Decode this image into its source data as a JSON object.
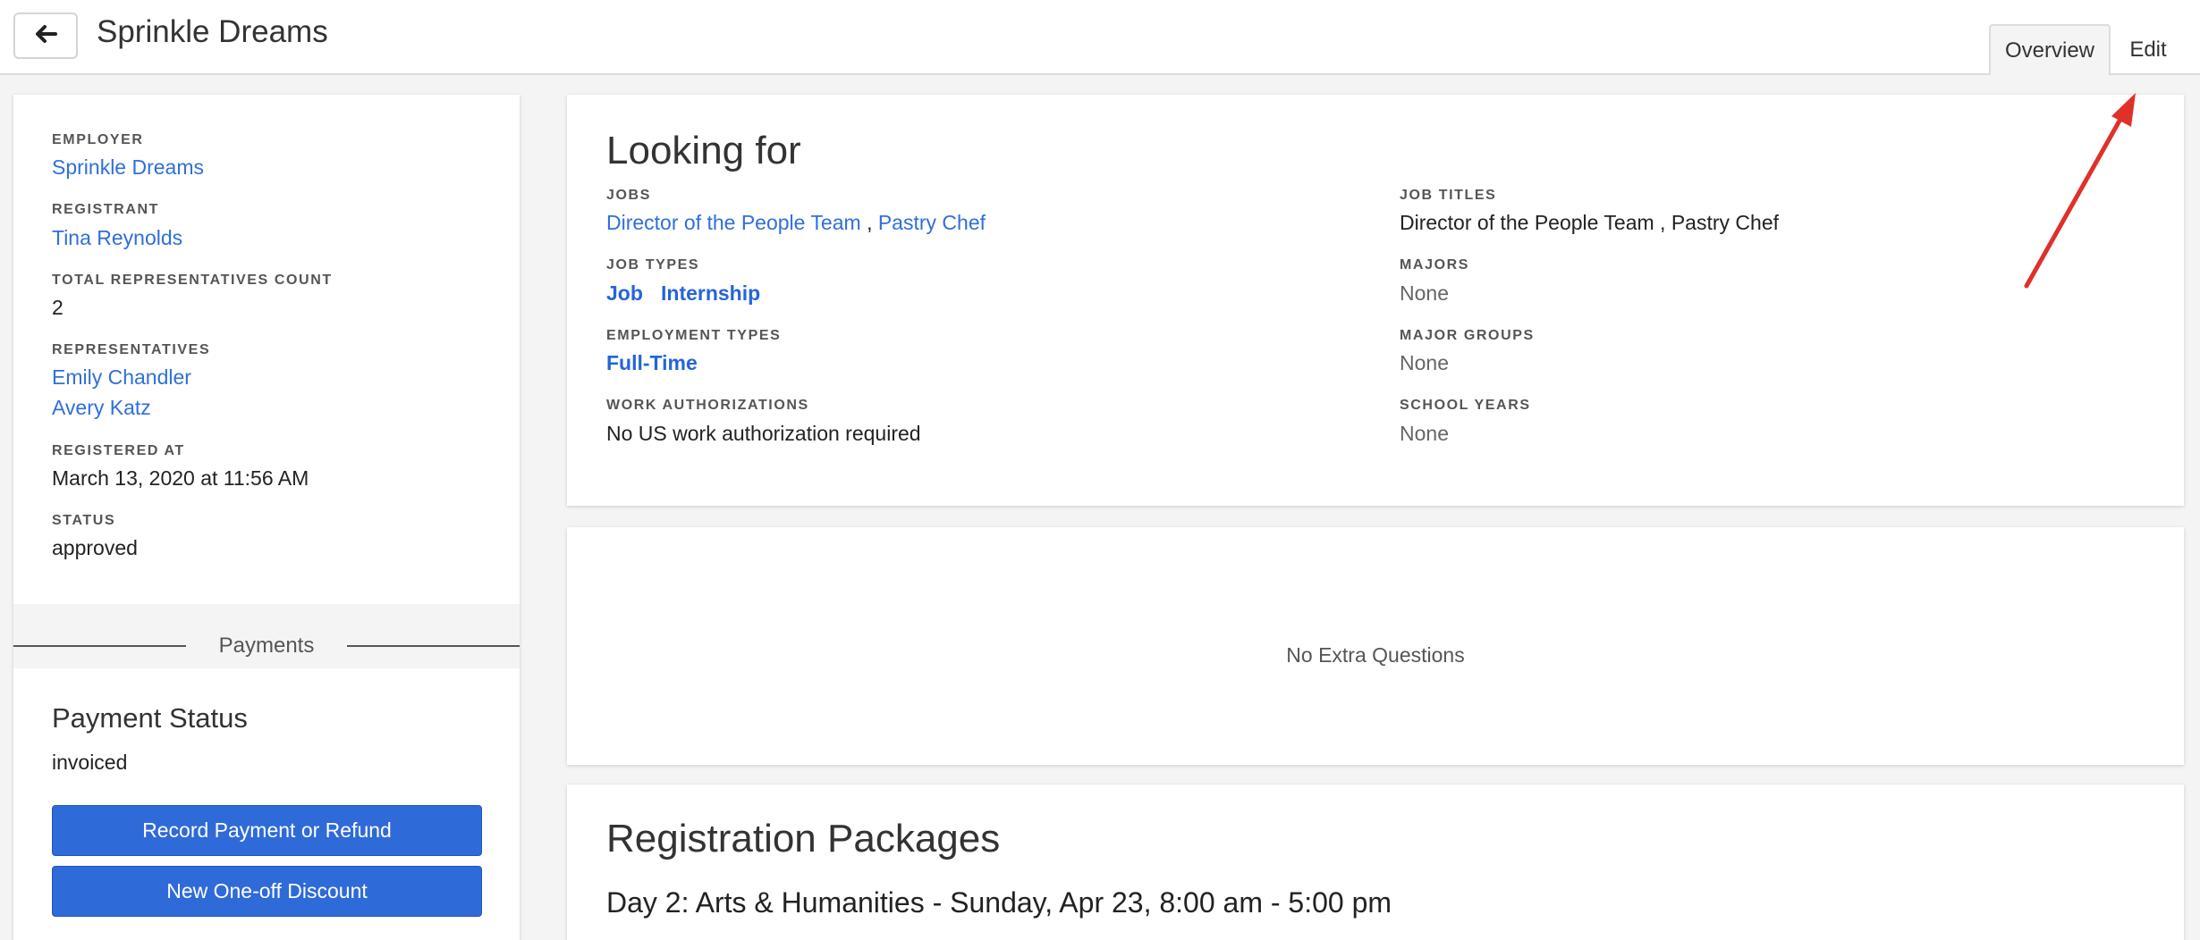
{
  "header": {
    "title": "Sprinkle Dreams",
    "back_icon": "arrow-left-icon",
    "tabs": [
      {
        "label": "Overview",
        "active": true
      },
      {
        "label": "Edit",
        "active": false
      }
    ]
  },
  "sidebar": {
    "employer_label": "EMPLOYER",
    "employer": "Sprinkle Dreams",
    "registrant_label": "REGISTRANT",
    "registrant": "Tina Reynolds",
    "count_label": "TOTAL REPRESENTATIVES COUNT",
    "count": "2",
    "reps_label": "REPRESENTATIVES",
    "reps": [
      "Emily Chandler",
      "Avery Katz"
    ],
    "registered_label": "REGISTERED AT",
    "registered": "March 13, 2020 at 11:56 AM",
    "status_label": "STATUS",
    "status": "approved"
  },
  "payments": {
    "section_title": "Payments",
    "status_title": "Payment Status",
    "status": "invoiced",
    "record_button": "Record Payment or Refund",
    "discount_button": "New One-off Discount"
  },
  "looking_for": {
    "title": "Looking for",
    "jobs_label": "JOBS",
    "jobs": [
      "Director of the People Team",
      "Pastry Chef"
    ],
    "jobs_sep": ",",
    "job_types_label": "JOB TYPES",
    "job_types": [
      "Job",
      "Internship"
    ],
    "employment_types_label": "EMPLOYMENT TYPES",
    "employment_types": [
      "Full-Time"
    ],
    "work_auth_label": "WORK AUTHORIZATIONS",
    "work_auth": "No US work authorization required",
    "job_titles_label": "JOB TITLES",
    "job_titles": "Director of the People Team , Pastry Chef",
    "majors_label": "MAJORS",
    "majors": "None",
    "major_groups_label": "MAJOR GROUPS",
    "major_groups": "None",
    "school_years_label": "SCHOOL YEARS",
    "school_years": "None"
  },
  "extra": {
    "text": "No Extra Questions"
  },
  "packages": {
    "title": "Registration Packages",
    "items": [
      "Day 2: Arts & Humanities - Sunday, Apr 23, 8:00 am - 5:00 pm"
    ]
  },
  "colors": {
    "link": "#2f6fdb",
    "primary_button": "#2f6ad9",
    "annotation_arrow": "#e0302a"
  }
}
